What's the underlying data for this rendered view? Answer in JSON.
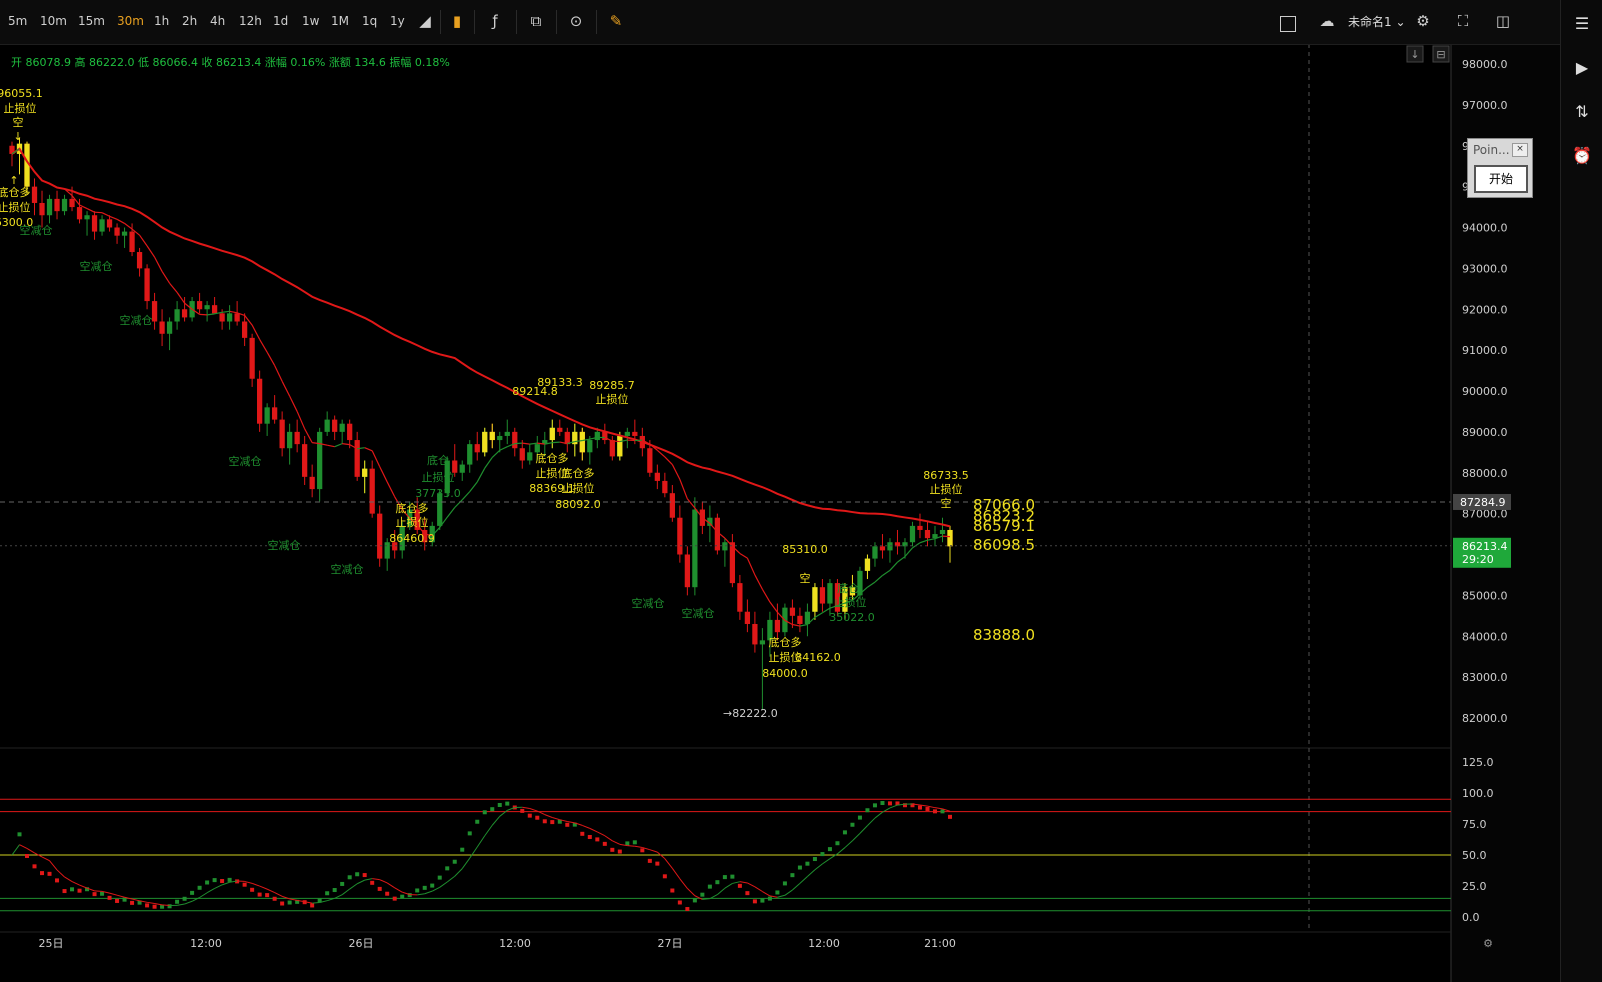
{
  "toolbar": {
    "timeframes": [
      "5m",
      "10m",
      "15m",
      "30m",
      "1h",
      "2h",
      "4h",
      "12h",
      "1d",
      "1w",
      "1M",
      "1q",
      "1y"
    ],
    "active_timeframe": "30m",
    "chart_name": "未命名1"
  },
  "ohlc_bar": {
    "text": "开 86078.9 高 86222.0 低 86066.4 收 86213.4 涨幅 0.16% 涨额 134.6 振幅 0.18%"
  },
  "point_widget": {
    "title": "Poin...",
    "start_label": "开始",
    "close_label": "×"
  },
  "colors": {
    "up": "#1f8f2f",
    "down": "#e01818",
    "signal": "#f0e020",
    "ma_long": "#e01818",
    "ma_short_up": "#1f8f2f",
    "ma_short_down": "#e01818",
    "price_tag": "#1fa83a",
    "line_price_tag": "#444"
  },
  "chart_data": {
    "type": "candlestick",
    "price_axis": {
      "min": 81500,
      "max": 98500,
      "ticks": [
        "98000.0",
        "97000.0",
        "96000.0",
        "95000.0",
        "94000.0",
        "93000.0",
        "92000.0",
        "91000.0",
        "90000.0",
        "89000.0",
        "88000.0",
        "87000.0",
        "86000.0",
        "85000.0",
        "84000.0",
        "83000.0",
        "82000.0"
      ]
    },
    "time_axis": [
      "25日",
      "12:00",
      "26日",
      "12:00",
      "27日",
      "12:00",
      "21:00"
    ],
    "current_price": "86213.4",
    "countdown": "29:20",
    "line_price": "87284.9",
    "right_levels": [
      "87066.0",
      "86823.2",
      "86579.1",
      "86098.5",
      "83888.0"
    ],
    "signals": [
      {
        "text": "96055.1",
        "price": 96055.1
      },
      {
        "text": "止损位"
      },
      {
        "text": "空"
      },
      {
        "text": "底仓多"
      },
      {
        "text": "止损位"
      },
      {
        "text": "6300.0"
      },
      {
        "text": "空减仓"
      },
      {
        "text": "空减仓"
      },
      {
        "text": "空减仓"
      },
      {
        "text": "空减仓"
      },
      {
        "text": "空减仓"
      },
      {
        "text": "空减仓"
      },
      {
        "text": "空减仓"
      },
      {
        "text": "空减仓"
      },
      {
        "text": "底仓多"
      },
      {
        "text": "止损位"
      },
      {
        "text": "86460.9"
      },
      {
        "text": "37733.0"
      },
      {
        "text": "底仓"
      },
      {
        "text": "止损位"
      },
      {
        "text": "89214.8"
      },
      {
        "text": "89133.3"
      },
      {
        "text": "89285.7"
      },
      {
        "text": "止损位"
      },
      {
        "text": "底仓多"
      },
      {
        "text": "止损位"
      },
      {
        "text": "88369.1"
      },
      {
        "text": "底仓多"
      },
      {
        "text": "止损位"
      },
      {
        "text": "88092.0"
      },
      {
        "text": "85310.0"
      },
      {
        "text": "空"
      },
      {
        "text": "底仓多"
      },
      {
        "text": "止损位"
      },
      {
        "text": "84000.0"
      },
      {
        "text": "84162.0"
      },
      {
        "text": "底仓"
      },
      {
        "text": "止损位"
      },
      {
        "text": "35022.0"
      },
      {
        "text": "86733.5"
      },
      {
        "text": "→82222.0"
      }
    ],
    "oscillator": {
      "ticks": [
        "125.0",
        "100.0",
        "75.0",
        "50.0",
        "25.0",
        "0.0"
      ],
      "levels": [
        95,
        85,
        50,
        15,
        5
      ],
      "min": 0,
      "max": 125
    },
    "candles": [
      [
        96000,
        96100,
        95500,
        95800
      ],
      [
        95800,
        96200,
        95300,
        96050
      ],
      [
        96050,
        96100,
        94800,
        95000
      ],
      [
        95000,
        95200,
        94300,
        94600
      ],
      [
        94600,
        94900,
        94000,
        94300
      ],
      [
        94300,
        94800,
        94100,
        94700
      ],
      [
        94700,
        94900,
        94200,
        94400
      ],
      [
        94400,
        94800,
        94300,
        94700
      ],
      [
        94700,
        95000,
        94400,
        94500
      ],
      [
        94500,
        94700,
        94100,
        94200
      ],
      [
        94200,
        94400,
        93800,
        94300
      ],
      [
        94300,
        94400,
        93700,
        93900
      ],
      [
        93900,
        94300,
        93800,
        94200
      ],
      [
        94200,
        94300,
        93900,
        94000
      ],
      [
        94000,
        94100,
        93600,
        93800
      ],
      [
        93800,
        94000,
        93500,
        93900
      ],
      [
        93900,
        94100,
        93300,
        93400
      ],
      [
        93400,
        93500,
        92800,
        93000
      ],
      [
        93000,
        93100,
        92000,
        92200
      ],
      [
        92200,
        92400,
        91500,
        91700
      ],
      [
        91700,
        92000,
        91100,
        91400
      ],
      [
        91400,
        91800,
        91000,
        91700
      ],
      [
        91700,
        92200,
        91500,
        92000
      ],
      [
        92000,
        92300,
        91700,
        91800
      ],
      [
        91800,
        92300,
        91700,
        92200
      ],
      [
        92200,
        92400,
        91900,
        92000
      ],
      [
        92000,
        92200,
        91700,
        92100
      ],
      [
        92100,
        92300,
        91900,
        91900
      ],
      [
        91900,
        92000,
        91500,
        91700
      ],
      [
        91700,
        92100,
        91500,
        91900
      ],
      [
        91900,
        92200,
        91600,
        91700
      ],
      [
        91700,
        91900,
        91100,
        91300
      ],
      [
        91300,
        91400,
        90100,
        90300
      ],
      [
        90300,
        90500,
        89000,
        89200
      ],
      [
        89200,
        89700,
        88900,
        89600
      ],
      [
        89600,
        89900,
        89200,
        89300
      ],
      [
        89300,
        89500,
        88400,
        88600
      ],
      [
        88600,
        89200,
        88200,
        89000
      ],
      [
        89000,
        89300,
        88500,
        88700
      ],
      [
        88700,
        88900,
        87700,
        87900
      ],
      [
        87900,
        88200,
        87400,
        87600
      ],
      [
        87600,
        89100,
        87300,
        89000
      ],
      [
        89000,
        89500,
        88900,
        89300
      ],
      [
        89300,
        89400,
        88800,
        89000
      ],
      [
        89000,
        89300,
        88700,
        89200
      ],
      [
        89200,
        89300,
        88600,
        88800
      ],
      [
        88800,
        89000,
        87800,
        87900
      ],
      [
        87900,
        88300,
        87500,
        88100
      ],
      [
        88100,
        88300,
        86900,
        87000
      ],
      [
        87000,
        87200,
        85700,
        85900
      ],
      [
        85900,
        86400,
        85600,
        86300
      ],
      [
        86300,
        86600,
        85900,
        86100
      ],
      [
        86100,
        86800,
        85900,
        86700
      ],
      [
        86700,
        87300,
        86600,
        87100
      ],
      [
        87100,
        87400,
        86500,
        86600
      ],
      [
        86600,
        86900,
        86100,
        86300
      ],
      [
        86300,
        86800,
        86200,
        86700
      ],
      [
        86700,
        87600,
        86600,
        87500
      ],
      [
        87500,
        88400,
        87400,
        88300
      ],
      [
        88300,
        88700,
        87900,
        88000
      ],
      [
        88000,
        88300,
        87800,
        88200
      ],
      [
        88200,
        88800,
        88000,
        88700
      ],
      [
        88700,
        89000,
        88300,
        88500
      ],
      [
        88500,
        89100,
        88400,
        89000
      ],
      [
        89000,
        89200,
        88600,
        88800
      ],
      [
        88800,
        89000,
        88500,
        88900
      ],
      [
        88900,
        89300,
        88700,
        89000
      ],
      [
        89000,
        89100,
        88400,
        88600
      ],
      [
        88600,
        88800,
        88100,
        88300
      ],
      [
        88300,
        88700,
        88200,
        88500
      ],
      [
        88500,
        88900,
        88300,
        88700
      ],
      [
        88700,
        89000,
        88400,
        88800
      ],
      [
        88800,
        89300,
        88600,
        89100
      ],
      [
        89100,
        89300,
        88900,
        89000
      ],
      [
        89000,
        89100,
        88500,
        88700
      ],
      [
        88700,
        89200,
        88400,
        89000
      ],
      [
        89000,
        89100,
        88300,
        88500
      ],
      [
        88500,
        88900,
        88200,
        88800
      ],
      [
        88800,
        89100,
        88600,
        89000
      ],
      [
        89000,
        89200,
        88700,
        88800
      ],
      [
        88800,
        88900,
        88300,
        88400
      ],
      [
        88400,
        89000,
        88300,
        88900
      ],
      [
        88900,
        89100,
        88600,
        89000
      ],
      [
        89000,
        89300,
        88700,
        88900
      ],
      [
        88900,
        89100,
        88400,
        88600
      ],
      [
        88600,
        88800,
        87900,
        88000
      ],
      [
        88000,
        88200,
        87600,
        87800
      ],
      [
        87800,
        88000,
        87400,
        87500
      ],
      [
        87500,
        87700,
        86800,
        86900
      ],
      [
        86900,
        87200,
        85800,
        86000
      ],
      [
        86000,
        86200,
        85000,
        85200
      ],
      [
        85200,
        87400,
        85000,
        87100
      ],
      [
        87100,
        87300,
        86500,
        86700
      ],
      [
        86700,
        87200,
        86300,
        86900
      ],
      [
        86900,
        87000,
        86000,
        86100
      ],
      [
        86100,
        86400,
        85700,
        86300
      ],
      [
        86300,
        86500,
        85200,
        85300
      ],
      [
        85300,
        85500,
        84400,
        84600
      ],
      [
        84600,
        84900,
        84100,
        84300
      ],
      [
        84300,
        84600,
        83600,
        83800
      ],
      [
        83800,
        84200,
        82200,
        83900
      ],
      [
        83900,
        84600,
        83500,
        84400
      ],
      [
        84400,
        84800,
        83900,
        84100
      ],
      [
        84100,
        84800,
        84000,
        84700
      ],
      [
        84700,
        84900,
        84200,
        84500
      ],
      [
        84500,
        84700,
        84100,
        84300
      ],
      [
        84300,
        84800,
        84000,
        84600
      ],
      [
        84600,
        85300,
        84400,
        85200
      ],
      [
        85200,
        85400,
        84600,
        84800
      ],
      [
        84800,
        85400,
        84500,
        85300
      ],
      [
        85300,
        85400,
        84500,
        84600
      ],
      [
        84600,
        85300,
        84400,
        85200
      ],
      [
        85200,
        85500,
        84900,
        85000
      ],
      [
        85000,
        85700,
        84900,
        85600
      ],
      [
        85600,
        86000,
        85400,
        85900
      ],
      [
        85900,
        86300,
        85700,
        86200
      ],
      [
        86200,
        86500,
        85900,
        86100
      ],
      [
        86100,
        86400,
        85800,
        86300
      ],
      [
        86300,
        86600,
        86000,
        86200
      ],
      [
        86200,
        86400,
        85900,
        86300
      ],
      [
        86300,
        86800,
        86200,
        86700
      ],
      [
        86700,
        87000,
        86400,
        86600
      ],
      [
        86600,
        86800,
        86200,
        86400
      ],
      [
        86400,
        86700,
        86200,
        86500
      ],
      [
        86500,
        86900,
        86300,
        86600
      ],
      [
        86600,
        86700,
        85800,
        86200
      ]
    ]
  }
}
